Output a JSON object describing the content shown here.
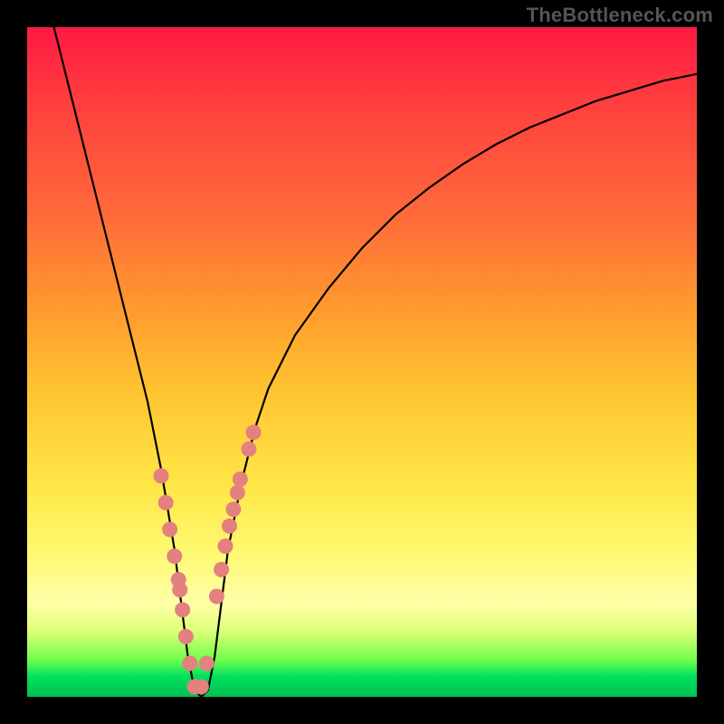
{
  "watermark": "TheBottleneck.com",
  "chart_data": {
    "type": "line",
    "title": "",
    "xlabel": "",
    "ylabel": "",
    "xlim": [
      0,
      100
    ],
    "ylim": [
      0,
      100
    ],
    "grid": false,
    "legend": false,
    "series": [
      {
        "name": "bottleneck-curve",
        "x": [
          4,
          6,
          8,
          10,
          12,
          14,
          16,
          18,
          20,
          21,
          22,
          23,
          24,
          25,
          26,
          27,
          28,
          29,
          30,
          32,
          34,
          36,
          40,
          45,
          50,
          55,
          60,
          65,
          70,
          75,
          80,
          85,
          90,
          95,
          100
        ],
        "y": [
          100,
          92,
          84,
          76,
          68,
          60,
          52,
          44,
          34,
          28,
          22,
          14,
          6,
          1,
          0,
          1,
          6,
          14,
          22,
          32,
          40,
          46,
          54,
          61,
          67,
          72,
          76,
          79.5,
          82.5,
          85,
          87,
          89,
          90.5,
          92,
          93
        ]
      }
    ],
    "markers": {
      "name": "sample-points",
      "color": "#e48080",
      "x": [
        20.0,
        20.7,
        21.3,
        22.8,
        22.0,
        22.6,
        23.2,
        23.7,
        24.3,
        25.0,
        26.0,
        26.8,
        28.3,
        29.0,
        29.6,
        30.2,
        30.8,
        31.4,
        31.8,
        33.1,
        33.8
      ],
      "y": [
        33.0,
        29.0,
        25.0,
        16.0,
        21.0,
        17.5,
        13.0,
        9.0,
        5.0,
        1.5,
        1.5,
        5.0,
        15.0,
        19.0,
        22.5,
        25.5,
        28.0,
        30.5,
        32.5,
        37.0,
        39.5
      ]
    },
    "colors": {
      "curve": "#000000",
      "marker": "#e48080",
      "background_top": "#ff1a44",
      "background_bottom": "#00c050",
      "frame": "#000000"
    }
  }
}
